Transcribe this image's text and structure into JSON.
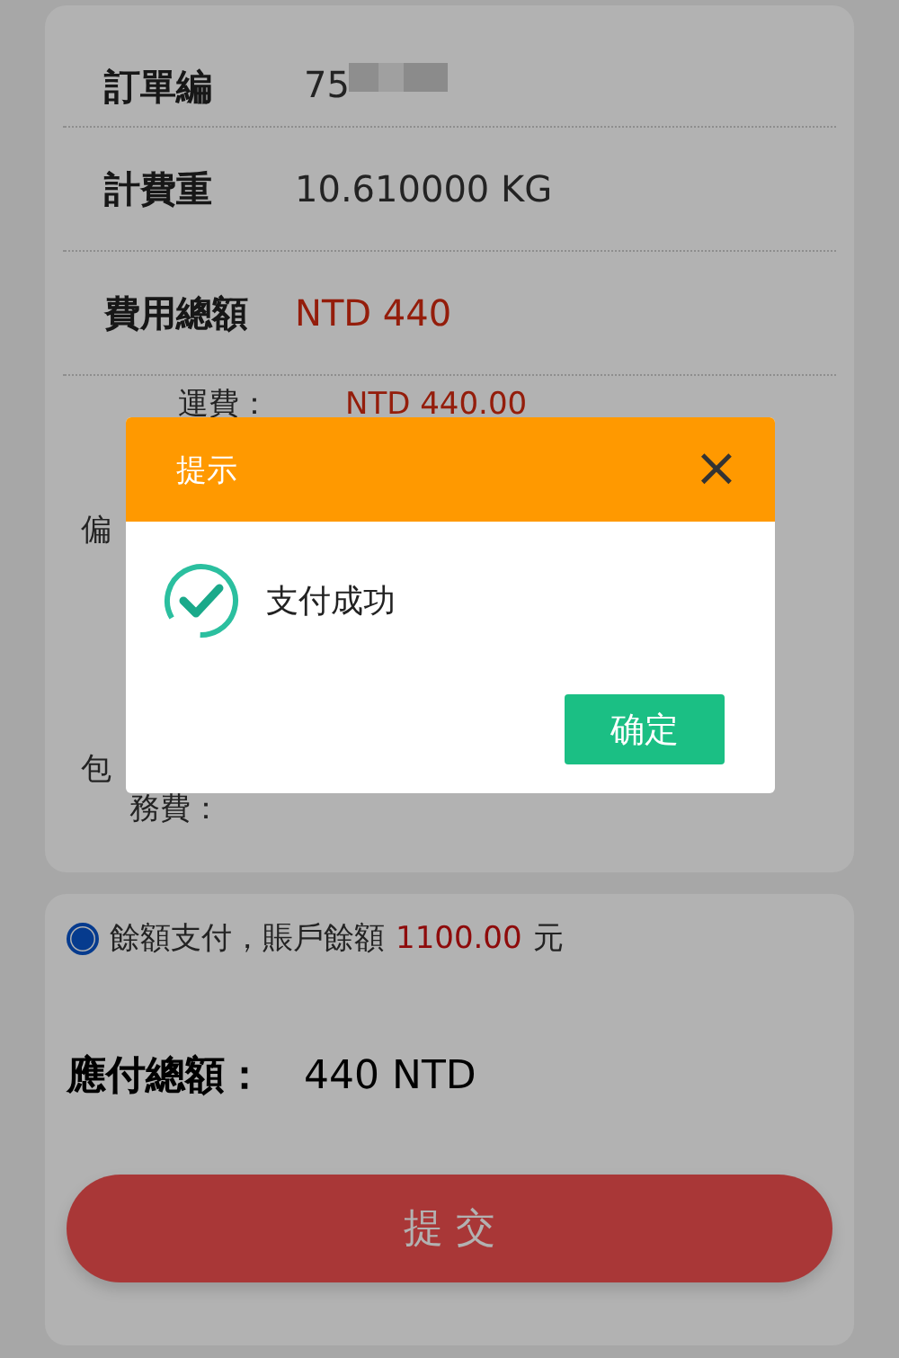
{
  "order": {
    "rows": [
      {
        "label": "訂單編",
        "value": "75",
        "redacted": true,
        "kind": "plain"
      },
      {
        "label": "計費重",
        "value": "10.610000 KG",
        "kind": "plain"
      },
      {
        "label": "費用總額",
        "value": "NTD 440",
        "kind": "money"
      }
    ],
    "charges": [
      {
        "label": "運費：",
        "value": "NTD 440.00"
      },
      {
        "label": "偏"
      },
      {
        "label": "包"
      },
      {
        "label": "務費："
      }
    ]
  },
  "payment": {
    "option": {
      "selected": true,
      "label": "餘額支付，賬戶餘額",
      "balance": "1100.00",
      "unit": "元"
    },
    "total_label": "應付總額：",
    "total_value": "440 NTD",
    "submit": "提 交"
  },
  "dialog": {
    "title": "提示",
    "close": "×",
    "message": "支付成功",
    "confirm": "确定"
  }
}
